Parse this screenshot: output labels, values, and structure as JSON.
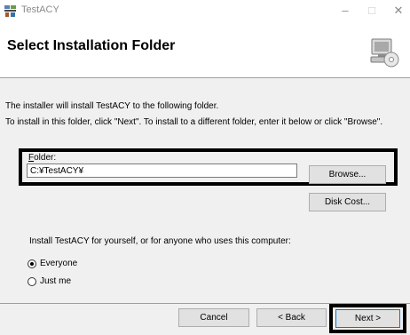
{
  "window": {
    "title": "TestACY",
    "controls": {
      "minimize": "–",
      "maximize": "□",
      "close": "✕"
    }
  },
  "header": {
    "title": "Select Installation Folder",
    "graphic_icon": "computer-disc-icon"
  },
  "body": {
    "description_line1": "The installer will install TestACY to the following folder.",
    "description_line2": "To install in this folder, click \"Next\". To install to a different folder, enter it below or click \"Browse\".",
    "folder": {
      "label_accesskey": "F",
      "label_rest": "older:",
      "value": "C:¥TestACY¥"
    },
    "browse_label": "Browse...",
    "disk_cost_label": "Disk Cost...",
    "install_for_text": "Install TestACY for yourself, or for anyone who uses this computer:",
    "radio_options": [
      {
        "label": "Everyone",
        "checked": true
      },
      {
        "label": "Just me",
        "checked": false
      }
    ]
  },
  "footer": {
    "cancel_label": "Cancel",
    "back_label": "< Back",
    "next_label": "Next >"
  },
  "colors": {
    "dialog_background": "#f0f0f0",
    "header_background": "#ffffff",
    "button_background": "#e1e1e1",
    "default_button_border": "#0078d7",
    "highlight_box": "#000000"
  }
}
